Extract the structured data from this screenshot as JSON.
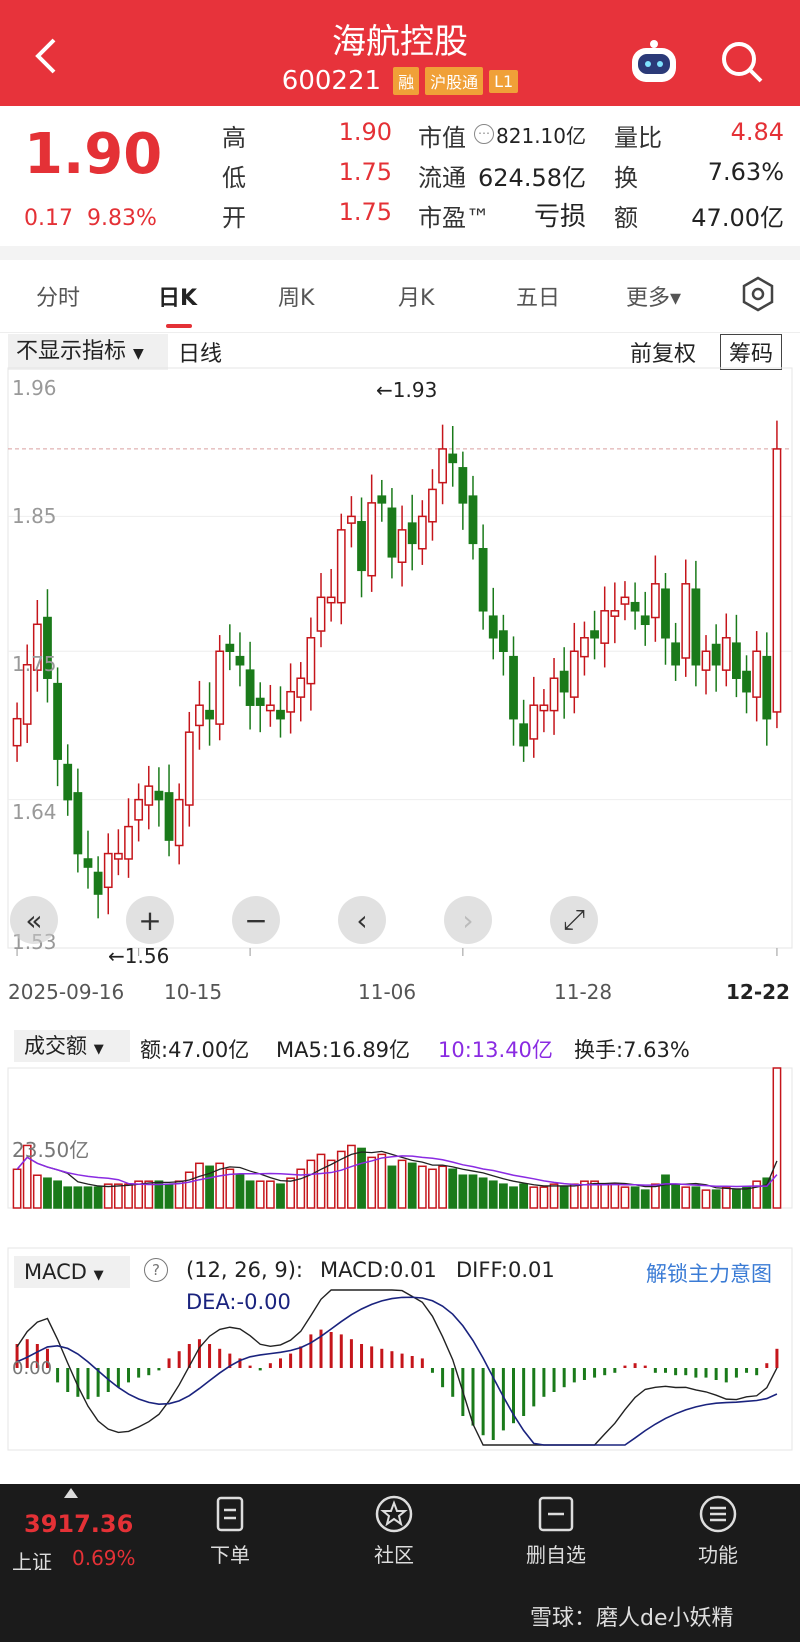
{
  "header": {
    "title": "海航控股",
    "code": "600221",
    "tags": [
      "融",
      "沪股通",
      "L1"
    ]
  },
  "quote": {
    "price": "1.90",
    "change": "0.17",
    "change_pct": "9.83%",
    "high_label": "高",
    "high": "1.90",
    "low_label": "低",
    "low": "1.75",
    "open_label": "开",
    "open": "1.75",
    "mktcap_label": "市值",
    "mktcap": "821.10亿",
    "float_label": "流通",
    "float": "624.58亿",
    "pe_label": "市盈™",
    "pe": "亏损",
    "vol_ratio_label": "量比",
    "vol_ratio": "4.84",
    "turnover_label": "换",
    "turnover": "7.63%",
    "amount_label": "额",
    "amount": "47.00亿"
  },
  "tabs": [
    "分时",
    "日K",
    "周K",
    "月K",
    "五日",
    "更多▾"
  ],
  "kline": {
    "indicator_select": "不显示指标",
    "period": "日线",
    "adjust": "前复权",
    "chip_btn": "筹码",
    "y_ticks": [
      "1.96",
      "1.85",
      "1.75",
      "1.64",
      "1.53"
    ],
    "max_label": "←1.93",
    "min_label": "←1.56",
    "dates": [
      "2025-09-16",
      "10-15",
      "11-06",
      "11-28",
      "12-22"
    ]
  },
  "volume": {
    "select": "成交额",
    "amount": "额:47.00亿",
    "ma5": "MA5:16.89亿",
    "ma10": "10:13.40亿",
    "turnover": "换手:7.63%",
    "tick": "23.50亿"
  },
  "macd": {
    "select": "MACD",
    "help": "?",
    "params": "(12, 26, 9):",
    "macd": "MACD:0.01",
    "diff": "DIFF:0.01",
    "dea": "DEA:-0.00",
    "unlock": "解锁主力意图",
    "zero": "0.00"
  },
  "bottom": {
    "index_value": "3917.36",
    "index_name": "上证",
    "index_pct": "0.69%",
    "nav": [
      "下单",
      "社区",
      "删自选",
      "功能"
    ],
    "watermark": "雪球：磨人de小妖精"
  },
  "chart_data": [
    {
      "type": "candlestick",
      "title": "",
      "ylim": [
        1.53,
        1.96
      ],
      "dates": [
        "2025-09-16",
        "10-15",
        "11-06",
        "11-28",
        "12-22"
      ],
      "last": {
        "open": 1.75,
        "high": 1.9,
        "low": 1.75,
        "close": 1.9
      },
      "max": 1.93,
      "min": 1.56,
      "closes": [
        1.7,
        1.74,
        1.77,
        1.73,
        1.67,
        1.64,
        1.6,
        1.59,
        1.57,
        1.6,
        1.6,
        1.62,
        1.64,
        1.65,
        1.64,
        1.61,
        1.64,
        1.69,
        1.71,
        1.7,
        1.75,
        1.75,
        1.74,
        1.71,
        1.71,
        1.71,
        1.7,
        1.72,
        1.73,
        1.76,
        1.79,
        1.79,
        1.84,
        1.85,
        1.81,
        1.86,
        1.86,
        1.82,
        1.84,
        1.83,
        1.85,
        1.87,
        1.9,
        1.89,
        1.86,
        1.83,
        1.78,
        1.76,
        1.75,
        1.7,
        1.68,
        1.71,
        1.71,
        1.73,
        1.72,
        1.75,
        1.76,
        1.76,
        1.78,
        1.78,
        1.79,
        1.78,
        1.77,
        1.8,
        1.76,
        1.74,
        1.8,
        1.74,
        1.75,
        1.74,
        1.76,
        1.73,
        1.72,
        1.75,
        1.7,
        1.9
      ]
    },
    {
      "type": "bar",
      "title": "成交额",
      "values": [
        13,
        21,
        11,
        10,
        9,
        7,
        7,
        7,
        7,
        8,
        8,
        8,
        9,
        9,
        9,
        8,
        9,
        12,
        15,
        14,
        15,
        13,
        11,
        9,
        9,
        9,
        8,
        10,
        13,
        16,
        18,
        16,
        19,
        21,
        20,
        17,
        18,
        14,
        16,
        15,
        14,
        13,
        14,
        13,
        11,
        11,
        10,
        9,
        8,
        7,
        8,
        7,
        7,
        8,
        7,
        8,
        9,
        9,
        8,
        8,
        7,
        7,
        6,
        8,
        11,
        8,
        7,
        7,
        6,
        6,
        7,
        6,
        7,
        9,
        10,
        47
      ],
      "ylim": [
        0,
        47
      ],
      "tick": "23.50亿"
    },
    {
      "type": "bar",
      "title": "MACD",
      "zero": 0,
      "values": [
        0.01,
        0.012,
        0.01,
        0.008,
        -0.006,
        -0.01,
        -0.012,
        -0.013,
        -0.012,
        -0.01,
        -0.008,
        -0.006,
        -0.004,
        -0.003,
        -0.001,
        0.004,
        0.007,
        0.01,
        0.012,
        0.01,
        0.008,
        0.006,
        0.004,
        0.001,
        -0.001,
        0.002,
        0.004,
        0.006,
        0.009,
        0.014,
        0.016,
        0.015,
        0.014,
        0.012,
        0.01,
        0.009,
        0.008,
        0.007,
        0.006,
        0.005,
        0.004,
        -0.002,
        -0.008,
        -0.012,
        -0.02,
        -0.024,
        -0.028,
        -0.03,
        -0.026,
        -0.023,
        -0.02,
        -0.016,
        -0.012,
        -0.01,
        -0.008,
        -0.006,
        -0.005,
        -0.004,
        -0.003,
        -0.002,
        0.001,
        0.002,
        0.001,
        -0.002,
        -0.002,
        -0.003,
        -0.003,
        -0.004,
        -0.004,
        -0.005,
        -0.006,
        -0.004,
        -0.002,
        -0.003,
        0.002,
        0.008
      ]
    }
  ],
  "colors": {
    "header": "#e7333b",
    "up": "#c5151b",
    "down": "#1a7a1a",
    "ma10": "#8a2be2"
  }
}
